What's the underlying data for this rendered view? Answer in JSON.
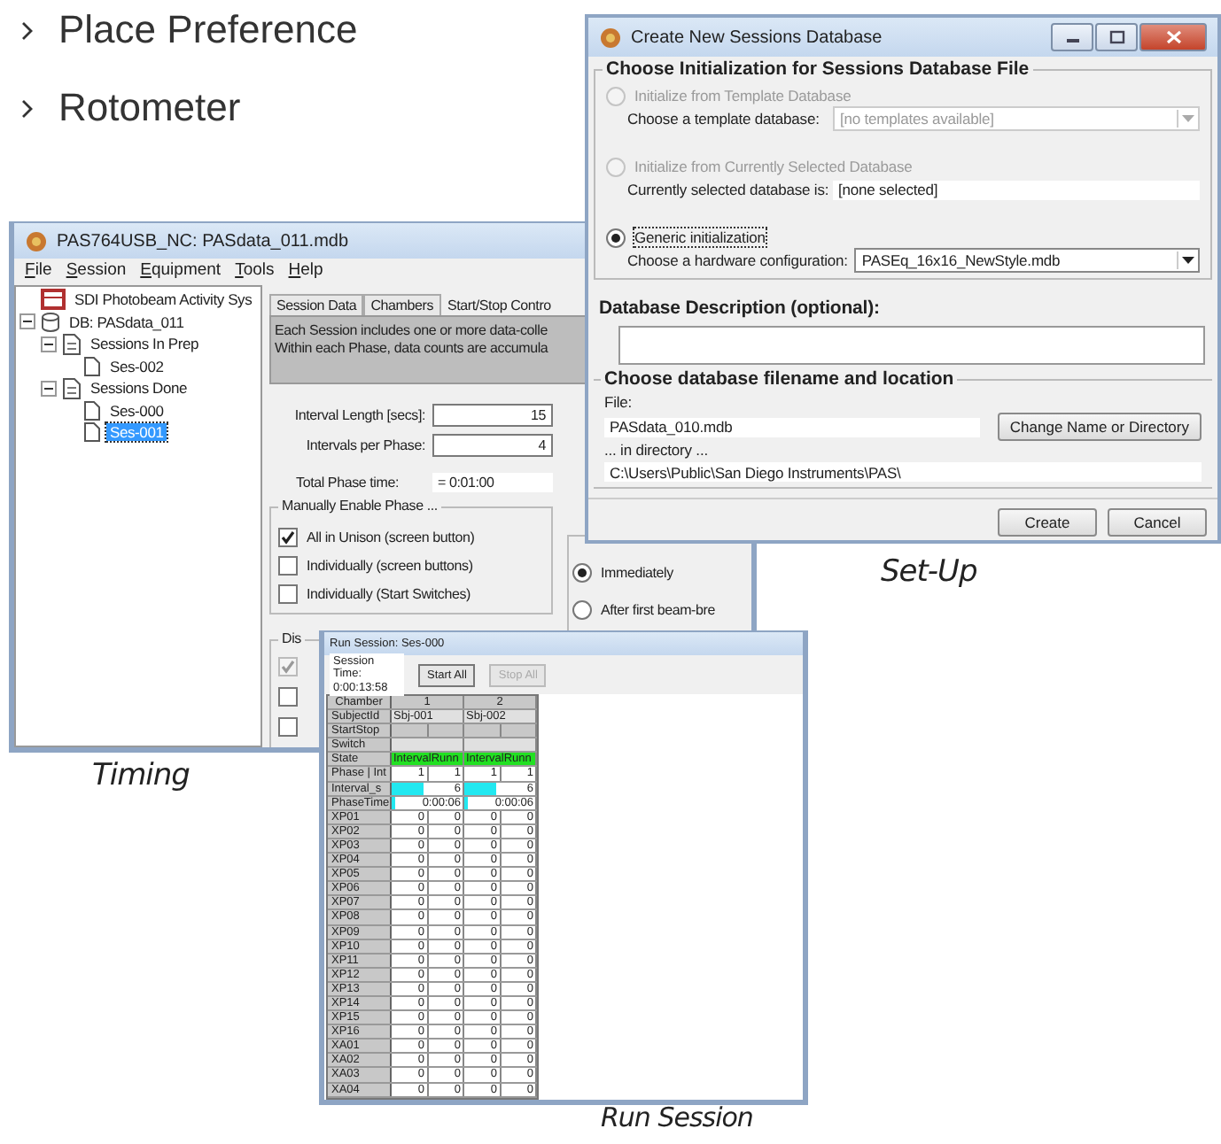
{
  "bullets": [
    {
      "label": "Place Preference"
    },
    {
      "label": "Rotometer"
    }
  ],
  "timing_window": {
    "title": "PAS764USB_NC: PASdata_011.mdb",
    "menu": [
      "File",
      "Session",
      "Equipment",
      "Tools",
      "Help"
    ],
    "tree": [
      {
        "label": "SDI Photobeam Activity Sys",
        "kind": "chamber",
        "selected": false
      },
      {
        "label": "DB: PASdata_011",
        "kind": "database",
        "selected": false,
        "expanded": true,
        "children": [
          {
            "label": "Sessions In Prep",
            "kind": "folder",
            "selected": false,
            "expanded": true,
            "children": [
              {
                "label": "Ses-002",
                "kind": "document",
                "selected": false
              }
            ]
          },
          {
            "label": "Sessions Done",
            "kind": "folder",
            "selected": false,
            "expanded": true,
            "children": [
              {
                "label": "Ses-000",
                "kind": "document",
                "selected": false
              },
              {
                "label": "Ses-001",
                "kind": "document",
                "selected": true
              }
            ]
          }
        ]
      }
    ],
    "tabs": [
      {
        "label": "Session Data",
        "selected": false
      },
      {
        "label": "Chambers",
        "selected": false
      },
      {
        "label": "Start/Stop Contro",
        "selected": true
      }
    ],
    "description": [
      "Each Session includes one or more data-colle",
      "Within each Phase, data counts are accumula"
    ],
    "fields": [
      {
        "label": "Interval Length [secs]:",
        "value": "15"
      },
      {
        "label": "Intervals per Phase:",
        "value": "4"
      }
    ],
    "total": {
      "label": "Total Phase time:",
      "value": "= 0:01:00"
    },
    "manual_group": {
      "title": "Manually Enable Phase ...",
      "options": [
        {
          "label": "All in Unison (screen button)",
          "checked": true
        },
        {
          "label": "Individually (screen buttons)",
          "checked": false
        },
        {
          "label": "Individually (Start Switches)",
          "checked": false
        }
      ]
    },
    "start_group": {
      "options": [
        {
          "label": "Immediately",
          "selected": true
        },
        {
          "label": "After first beam-bre",
          "selected": false
        }
      ]
    },
    "display_group": {
      "title": "Dis",
      "options": [
        {
          "checked": true,
          "disabled": true
        },
        {
          "checked": false,
          "disabled": false
        },
        {
          "checked": false,
          "disabled": false
        }
      ]
    }
  },
  "timing_caption": "Timing",
  "setup_window": {
    "title": "Create New Sessions Database",
    "init_group": {
      "title": "Choose Initialization for Sessions Database File",
      "options": [
        {
          "label": "Initialize from Template Database",
          "selected": false,
          "disabled": true,
          "kind": "dropdown",
          "field_label": "Choose a template database:",
          "field_value": "[no templates available]"
        },
        {
          "label": "Initialize from Currently Selected Database",
          "selected": false,
          "disabled": true,
          "kind": "readout",
          "field_label": "Currently selected database is:",
          "field_value": "[none selected]"
        },
        {
          "label": "Generic initialization",
          "selected": true,
          "disabled": false,
          "kind": "dropdown",
          "field_label": "Choose a hardware configuration:",
          "field_value": "PASEq_16x16_NewStyle.mdb"
        }
      ]
    },
    "description_label": "Database Description (optional):",
    "file_group": {
      "title": "Choose database filename and location",
      "file_label": "File:",
      "file_value": "PASdata_010.mdb",
      "change_button": "Change Name or Directory",
      "dir_label": "... in directory ...",
      "dir_value": "C:\\Users\\Public\\San Diego Instruments\\PAS\\"
    },
    "buttons": [
      "Create",
      "Cancel"
    ]
  },
  "setup_caption": "Set-Up",
  "run_window": {
    "title": "Run Session: Ses-000",
    "session_time_label": "Session Time:",
    "session_time": "0:00:13:58",
    "buttons": [
      {
        "label": "Start All",
        "disabled": false
      },
      {
        "label": "Stop All",
        "disabled": true
      }
    ],
    "rows": [
      {
        "label": "Chamber",
        "kind": "header",
        "cells": [
          "1",
          "2"
        ]
      },
      {
        "label": "SubjectId",
        "kind": "span",
        "cells": [
          "Sbj-001",
          "Sbj-002"
        ]
      },
      {
        "label": "StartStop",
        "kind": "split",
        "cells": [
          "",
          "",
          "",
          ""
        ]
      },
      {
        "label": "Switch",
        "kind": "span",
        "cells": [
          "",
          ""
        ]
      },
      {
        "label": "State",
        "kind": "state",
        "cells": [
          "IntervalRunn",
          "IntervalRunn"
        ]
      },
      {
        "label": "Phase | Int",
        "kind": "split",
        "cells": [
          "1",
          "1",
          "1",
          "1"
        ]
      },
      {
        "label": "Interval_s",
        "kind": "bar",
        "cells": [
          {
            "value": "6",
            "level": 0.45
          },
          {
            "value": "6",
            "level": 0.45
          }
        ]
      },
      {
        "label": "PhaseTime",
        "kind": "bar",
        "cells": [
          {
            "value": "0:00:06",
            "level": 0.06
          },
          {
            "value": "0:00:06",
            "level": 0.06
          }
        ]
      },
      {
        "label": "XP01",
        "kind": "split",
        "cells": [
          "0",
          "0",
          "0",
          "0"
        ]
      },
      {
        "label": "XP02",
        "kind": "split",
        "cells": [
          "0",
          "0",
          "0",
          "0"
        ]
      },
      {
        "label": "XP03",
        "kind": "split",
        "cells": [
          "0",
          "0",
          "0",
          "0"
        ]
      },
      {
        "label": "XP04",
        "kind": "split",
        "cells": [
          "0",
          "0",
          "0",
          "0"
        ]
      },
      {
        "label": "XP05",
        "kind": "split",
        "cells": [
          "0",
          "0",
          "0",
          "0"
        ]
      },
      {
        "label": "XP06",
        "kind": "split",
        "cells": [
          "0",
          "0",
          "0",
          "0"
        ]
      },
      {
        "label": "XP07",
        "kind": "split",
        "cells": [
          "0",
          "0",
          "0",
          "0"
        ]
      },
      {
        "label": "XP08",
        "kind": "split",
        "cells": [
          "0",
          "0",
          "0",
          "0"
        ]
      },
      {
        "label": "XP09",
        "kind": "split",
        "cells": [
          "0",
          "0",
          "0",
          "0"
        ]
      },
      {
        "label": "XP10",
        "kind": "split",
        "cells": [
          "0",
          "0",
          "0",
          "0"
        ]
      },
      {
        "label": "XP11",
        "kind": "split",
        "cells": [
          "0",
          "0",
          "0",
          "0"
        ]
      },
      {
        "label": "XP12",
        "kind": "split",
        "cells": [
          "0",
          "0",
          "0",
          "0"
        ]
      },
      {
        "label": "XP13",
        "kind": "split",
        "cells": [
          "0",
          "0",
          "0",
          "0"
        ]
      },
      {
        "label": "XP14",
        "kind": "split",
        "cells": [
          "0",
          "0",
          "0",
          "0"
        ]
      },
      {
        "label": "XP15",
        "kind": "split",
        "cells": [
          "0",
          "0",
          "0",
          "0"
        ]
      },
      {
        "label": "XP16",
        "kind": "split",
        "cells": [
          "0",
          "0",
          "0",
          "0"
        ]
      },
      {
        "label": "XA01",
        "kind": "split",
        "cells": [
          "0",
          "0",
          "0",
          "0"
        ]
      },
      {
        "label": "XA02",
        "kind": "split",
        "cells": [
          "0",
          "0",
          "0",
          "0"
        ]
      },
      {
        "label": "XA03",
        "kind": "split",
        "cells": [
          "0",
          "0",
          "0",
          "0"
        ]
      },
      {
        "label": "XA04",
        "kind": "split",
        "cells": [
          "0",
          "0",
          "0",
          "0"
        ]
      }
    ]
  },
  "run_caption": "Run Session"
}
